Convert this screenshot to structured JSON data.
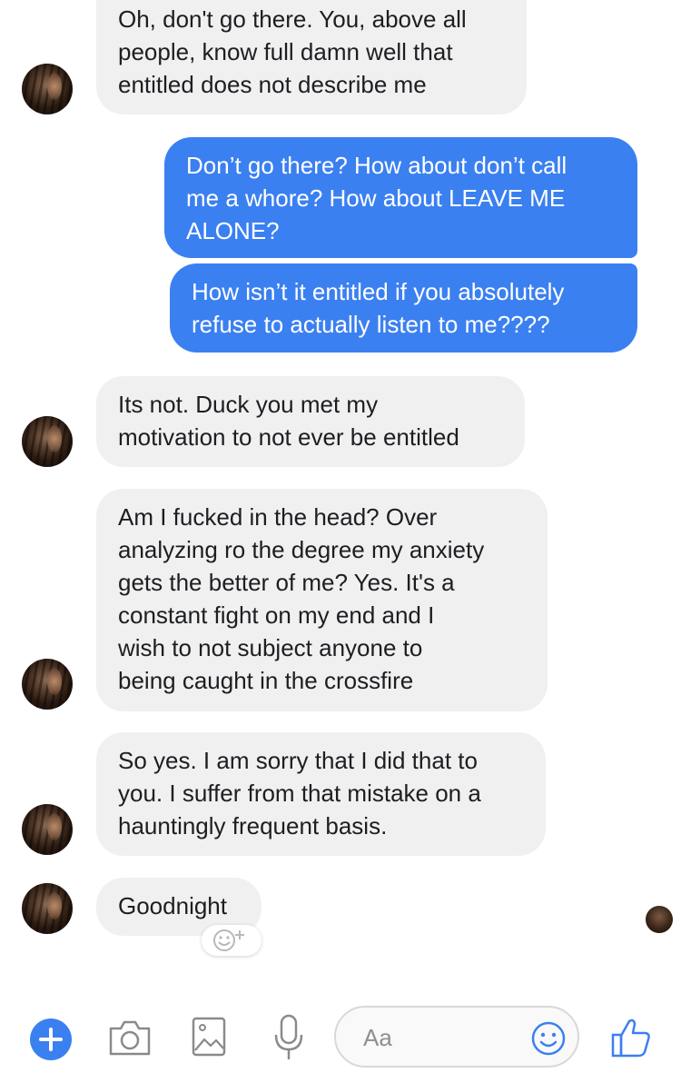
{
  "conversation": {
    "messages": [
      {
        "sender": "contact",
        "text": "Oh, don't go there. You, above all\npeople, know full damn well that\nentitled does not describe me"
      },
      {
        "sender": "me",
        "text": "Don’t go there? How about don’t call\nme a whore? How about LEAVE ME\nALONE?"
      },
      {
        "sender": "me",
        "text": "How isn’t it entitled if you absolutely\nrefuse to actually listen to me????"
      },
      {
        "sender": "contact",
        "text": "Its not. Duck you met my\nmotivation to not ever be entitled"
      },
      {
        "sender": "contact",
        "text": "Am I fucked in the head? Over\nanalyzing ro the degree my anxiety\ngets the better of me? Yes. It's a\nconstant fight on my end and I\nwish to not subject anyone to\nbeing caught in the crossfire"
      },
      {
        "sender": "contact",
        "text": "So yes. I am sorry that I did that to\nyou. I suffer from that mistake on a\nhauntingly frequent basis."
      },
      {
        "sender": "contact",
        "text": "Goodnight"
      }
    ]
  },
  "composer": {
    "placeholder": "Aa",
    "icons": [
      "plus-icon",
      "camera-icon",
      "gallery-icon",
      "microphone-icon",
      "emoji-icon",
      "thumbs-up-icon"
    ],
    "accent_color": "#3b80f0"
  },
  "colors": {
    "outgoing_bubble": "#3b80f0",
    "incoming_bubble": "#f0f0f0"
  }
}
